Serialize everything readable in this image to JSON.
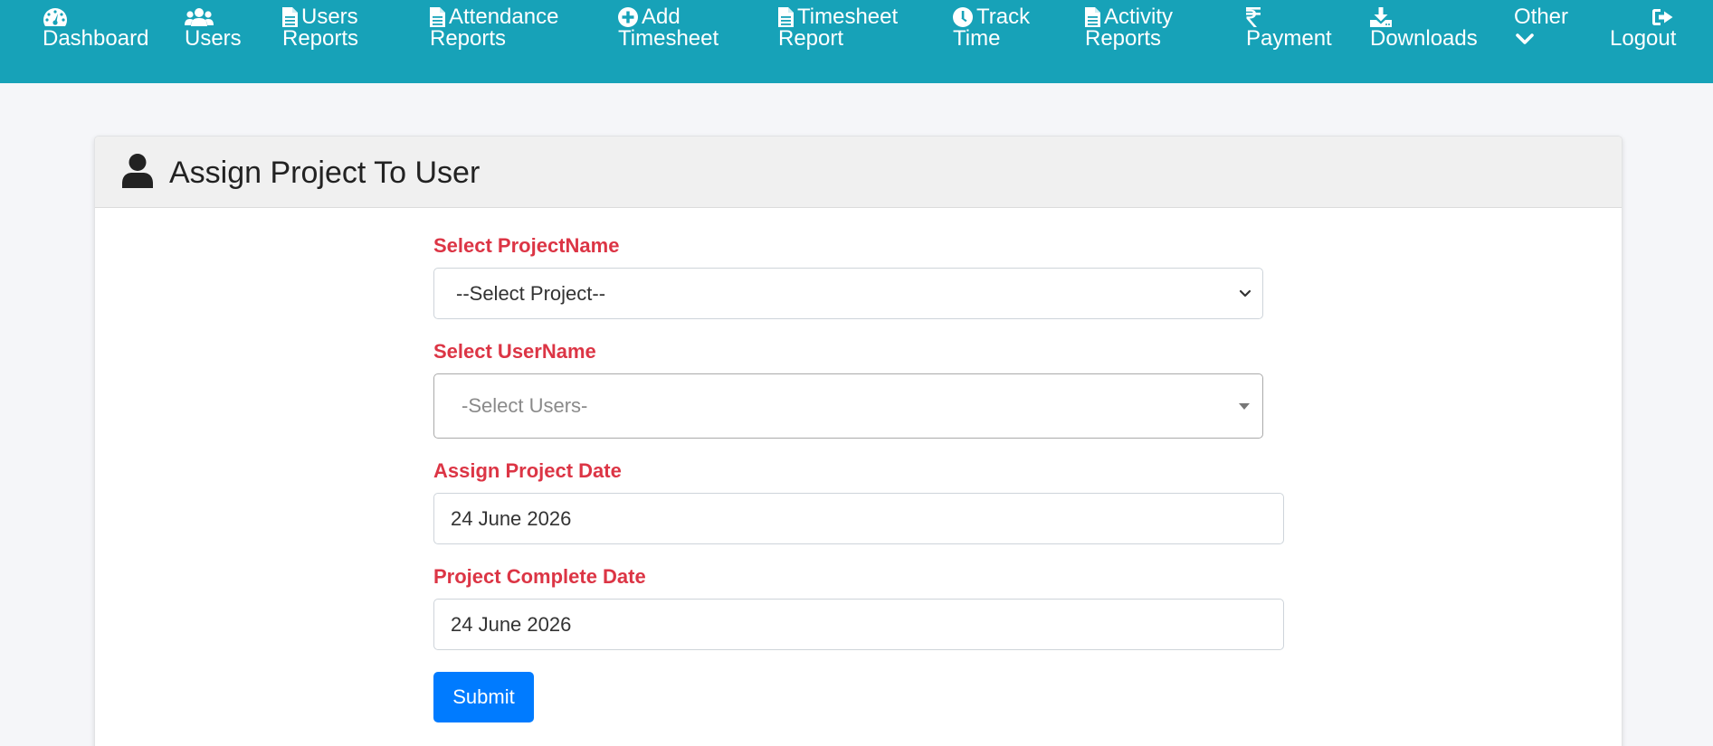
{
  "colors": {
    "navbar": "#17a2b8",
    "label": "#dc3545",
    "button": "#007bff"
  },
  "nav": {
    "dashboard": {
      "l1": "",
      "l2": "Dashboard",
      "icon": "tachometer-icon"
    },
    "users": {
      "l1": "",
      "l2": "Users",
      "icon": "users-icon"
    },
    "users_reports": {
      "l1": "Users",
      "l2": "Reports",
      "icon": "file-icon"
    },
    "attendance_reports": {
      "l1": "Attendance",
      "l2": "Reports",
      "icon": "file-icon"
    },
    "add_timesheet": {
      "l1": "Add",
      "l2": "Timesheet",
      "icon": "plus-circle-icon"
    },
    "timesheet_report": {
      "l1": "Timesheet",
      "l2": "Report",
      "icon": "file-icon"
    },
    "track_time": {
      "l1": "Track",
      "l2": "Time",
      "icon": "clock-icon"
    },
    "activity_reports": {
      "l1": "Activity",
      "l2": "Reports",
      "icon": "file-icon"
    },
    "payment": {
      "l1": "",
      "l2": "Payment",
      "icon": "rupee-icon"
    },
    "downloads": {
      "l1": "",
      "l2": "Downloads",
      "icon": "download-icon"
    },
    "other": {
      "l1": "Other",
      "l2": "",
      "icon": "chevron-down-icon"
    },
    "logout": {
      "l1": "",
      "l2": "Logout",
      "icon": "sign-out-icon"
    }
  },
  "card": {
    "title": "Assign Project To User",
    "icon": "user-icon"
  },
  "form": {
    "project": {
      "label": "Select ProjectName",
      "value": "--Select Project--"
    },
    "user": {
      "label": "Select UserName",
      "placeholder": "-Select Users-"
    },
    "assign_date": {
      "label": "Assign Project Date",
      "value": "24 June 2026"
    },
    "complete_date": {
      "label": "Project Complete Date",
      "value": "24 June 2026"
    },
    "submit": "Submit"
  }
}
